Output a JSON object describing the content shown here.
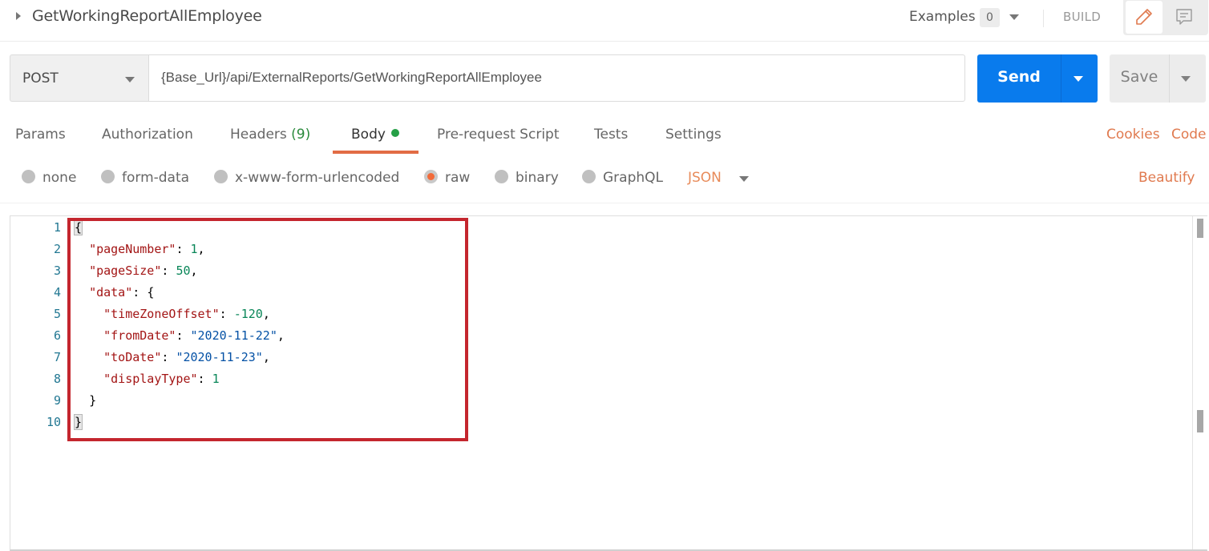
{
  "header": {
    "request_name": "GetWorkingReportAllEmployee",
    "examples_label": "Examples",
    "examples_count": "0",
    "build_label": "BUILD",
    "icons": {
      "expand": "caret-right-icon",
      "edit": "pencil-icon",
      "comments": "comment-icon"
    }
  },
  "request": {
    "method": "POST",
    "url": "{Base_Url}/api/ExternalReports/GetWorkingReportAllEmployee",
    "send_label": "Send",
    "save_label": "Save"
  },
  "tabs": [
    {
      "label": "Params"
    },
    {
      "label": "Authorization"
    },
    {
      "label": "Headers",
      "count": "(9)"
    },
    {
      "label": "Body",
      "active": true,
      "indicator": "green-dot"
    },
    {
      "label": "Pre-request Script"
    },
    {
      "label": "Tests"
    },
    {
      "label": "Settings"
    }
  ],
  "links": {
    "cookies": "Cookies",
    "code": "Code",
    "beautify": "Beautify"
  },
  "body_types": [
    {
      "label": "none",
      "selected": false
    },
    {
      "label": "form-data",
      "selected": false
    },
    {
      "label": "x-www-form-urlencoded",
      "selected": false
    },
    {
      "label": "raw",
      "selected": true
    },
    {
      "label": "binary",
      "selected": false
    },
    {
      "label": "GraphQL",
      "selected": false
    }
  ],
  "raw_format": "JSON",
  "editor": {
    "line_numbers": [
      "1",
      "2",
      "3",
      "4",
      "5",
      "6",
      "7",
      "8",
      "9",
      "10"
    ],
    "lines": [
      {
        "t1": "{"
      },
      {
        "indent": "  ",
        "key": "\"pageNumber\"",
        "sep": ": ",
        "num": "1",
        "end": ","
      },
      {
        "indent": "  ",
        "key": "\"pageSize\"",
        "sep": ": ",
        "num": "50",
        "end": ","
      },
      {
        "indent": "  ",
        "key": "\"data\"",
        "sep": ": ",
        "end": "{"
      },
      {
        "indent": "    ",
        "key": "\"timeZoneOffset\"",
        "sep": ": ",
        "num": "-120",
        "end": ","
      },
      {
        "indent": "    ",
        "key": "\"fromDate\"",
        "sep": ": ",
        "str": "\"2020-11-22\"",
        "end": ","
      },
      {
        "indent": "    ",
        "key": "\"toDate\"",
        "sep": ": ",
        "str": "\"2020-11-23\"",
        "end": ","
      },
      {
        "indent": "    ",
        "key": "\"displayType\"",
        "sep": ": ",
        "num": "1"
      },
      {
        "indent": "  ",
        "end": "}"
      },
      {
        "t1": "}"
      }
    ]
  },
  "colors": {
    "send_blue": "#097bed",
    "accent_orange": "#e26c45",
    "active_green": "#26a047",
    "highlight_red": "#c4262e"
  }
}
